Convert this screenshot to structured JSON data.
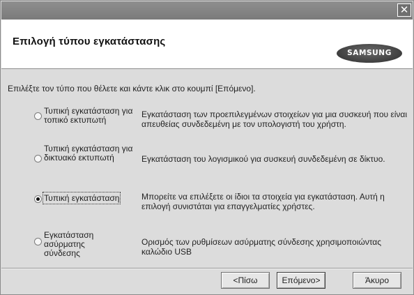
{
  "window": {
    "close_glyph": "✕"
  },
  "header": {
    "title": "Επιλογή τύπου εγκατάστασης",
    "logo_text": "SAMSUNG"
  },
  "instruction": "Επιλέξτε τον τύπο που θέλετε και κάντε κλικ στο κουμπί [Επόμενο].",
  "options": [
    {
      "label": "Τυπική εγκατάσταση για τοπικό εκτυπωτή",
      "description": "Εγκατάσταση των προεπιλεγμένων στοιχείων για μια συσκευή που είναι απευθείας συνδεδεμένη με τον υπολογιστή του χρήστη.",
      "selected": false
    },
    {
      "label": "Τυπική εγκατάσταση για δικτυακό εκτυπωτή",
      "description": "Εγκατάσταση του λογισμικού για συσκευή συνδεδεμένη σε δίκτυο.",
      "selected": false
    },
    {
      "label": "Τυπική εγκατάσταση",
      "description": "Μπορείτε να επιλέξετε οι ίδιοι τα στοιχεία για εγκατάσταση. Αυτή η επιλογή συνιστάται για επαγγελματίες χρήστες.",
      "selected": true
    },
    {
      "label": "Εγκατάσταση ασύρματης σύνδεσης",
      "description": "Ορισμός των ρυθμίσεων ασύρματης σύνδεσης χρησιμοποιώντας καλώδιο USB",
      "selected": false
    }
  ],
  "buttons": {
    "back": "<Πίσω",
    "next": "Επόμενο>",
    "cancel": "Άκυρο"
  }
}
